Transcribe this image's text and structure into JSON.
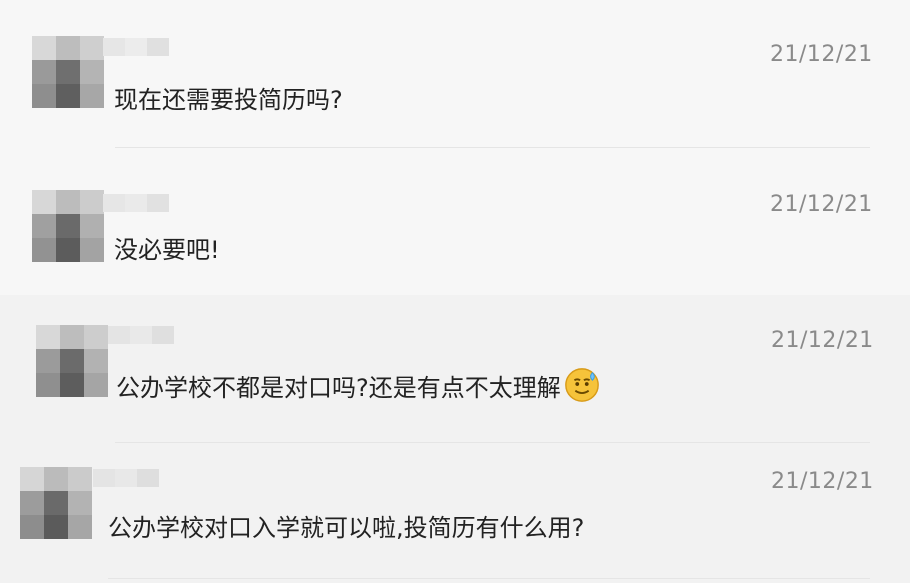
{
  "comments": [
    {
      "text": "现在还需要投简历吗?",
      "time": "21/12/21"
    },
    {
      "text": "没必要吧!",
      "time": "21/12/21"
    },
    {
      "text": "公办学校不都是对口吗?还是有点不太理解",
      "time": "21/12/21",
      "emoji": "sweat-smile-emoji"
    },
    {
      "text": "公办学校对口入学就可以啦,投简历有什么用?",
      "time": "21/12/21"
    }
  ],
  "colors": {
    "text": "#222222",
    "time": "#8a8a8a",
    "divider": "#e5e5e5",
    "bg_top": "#f7f7f7",
    "bg_bottom": "#f2f2f2"
  }
}
